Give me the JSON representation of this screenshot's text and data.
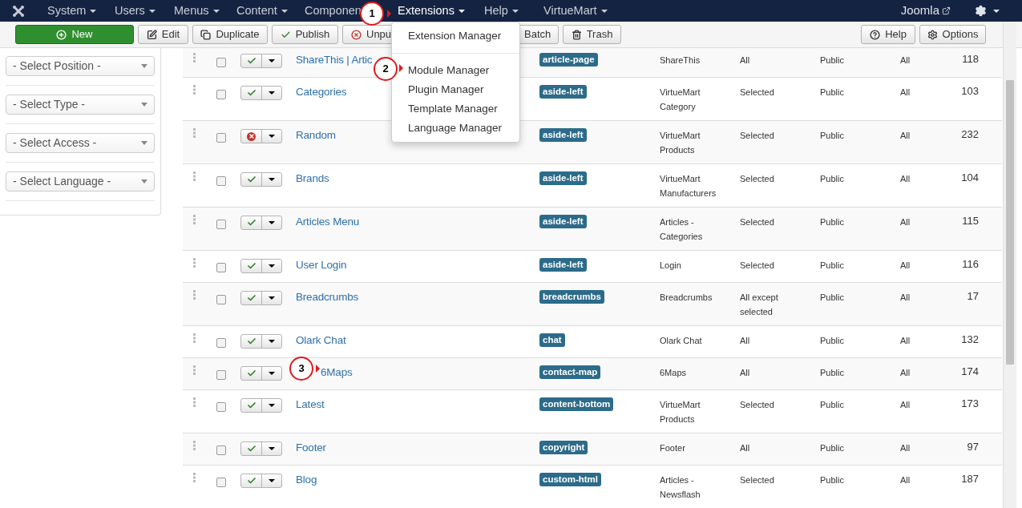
{
  "navbar": {
    "menus": [
      {
        "label": "System",
        "selected": false
      },
      {
        "label": "Users",
        "selected": false
      },
      {
        "label": "Menus",
        "selected": false
      },
      {
        "label": "Content",
        "selected": false
      },
      {
        "label": "Componen",
        "selected": false
      },
      {
        "label": "Extensions",
        "selected": true
      },
      {
        "label": "Help",
        "selected": false
      },
      {
        "label": "VirtueMart",
        "selected": false
      }
    ],
    "site_link": "Joomla"
  },
  "dropdown": {
    "items": [
      {
        "label": "Extension Manager",
        "kind": "item"
      },
      {
        "kind": "divider"
      },
      {
        "label": "Module Manager",
        "kind": "item"
      },
      {
        "label": "Plugin Manager",
        "kind": "item"
      },
      {
        "label": "Template Manager",
        "kind": "item"
      },
      {
        "label": "Language Manager",
        "kind": "item"
      }
    ]
  },
  "toolbar": {
    "left": [
      {
        "label": "New",
        "kind": "new"
      },
      {
        "label": "Edit",
        "kind": "edit"
      },
      {
        "label": "Duplicate",
        "kind": "duplicate"
      },
      {
        "label": "Publish",
        "kind": "publish"
      },
      {
        "label": "Unpu",
        "kind": "unpublish"
      },
      {
        "label": "Batch",
        "kind": "batch"
      },
      {
        "label": "Trash",
        "kind": "trash"
      }
    ],
    "right": [
      {
        "label": "Help",
        "kind": "help"
      },
      {
        "label": "Options",
        "kind": "options"
      }
    ]
  },
  "filters": [
    "- Select Position -",
    "- Select Type -",
    "- Select Access -",
    "- Select Language -"
  ],
  "rows": [
    {
      "title": "ShareThis | Artic",
      "published": true,
      "checked": false,
      "position": "article-page",
      "type": "ShareThis",
      "pages": "All",
      "access": "Public",
      "language": "All",
      "id": "118"
    },
    {
      "title": "Categories",
      "published": true,
      "checked": false,
      "position": "aside-left",
      "type": "VirtueMart Category",
      "pages": "Selected",
      "access": "Public",
      "language": "All",
      "id": "103"
    },
    {
      "title": "Random",
      "published": false,
      "checked": false,
      "position": "aside-left",
      "type": "VirtueMart Products",
      "pages": "Selected",
      "access": "Public",
      "language": "All",
      "id": "232"
    },
    {
      "title": "Brands",
      "published": true,
      "checked": false,
      "position": "aside-left",
      "type": "VirtueMart Manufacturers",
      "pages": "Selected",
      "access": "Public",
      "language": "All",
      "id": "104"
    },
    {
      "title": "Articles Menu",
      "published": true,
      "checked": false,
      "position": "aside-left",
      "type": "Articles - Categories",
      "pages": "Selected",
      "access": "Public",
      "language": "All",
      "id": "115"
    },
    {
      "title": "User Login",
      "published": true,
      "checked": false,
      "position": "aside-left",
      "type": "Login",
      "pages": "Selected",
      "access": "Public",
      "language": "All",
      "id": "116"
    },
    {
      "title": "Breadcrumbs",
      "published": true,
      "checked": false,
      "position": "breadcrumbs",
      "type": "Breadcrumbs",
      "pages": "All except selected",
      "access": "Public",
      "language": "All",
      "id": "17"
    },
    {
      "title": "Olark Chat",
      "published": true,
      "checked": false,
      "position": "chat",
      "type": "Olark Chat",
      "pages": "All",
      "access": "Public",
      "language": "All",
      "id": "132"
    },
    {
      "title": "6Maps",
      "published": true,
      "checked": false,
      "position": "contact-map",
      "type": "6Maps",
      "pages": "All",
      "access": "Public",
      "language": "All",
      "id": "174"
    },
    {
      "title": "Latest",
      "published": true,
      "checked": false,
      "position": "content-bottom",
      "type": "VirtueMart Products",
      "pages": "Selected",
      "access": "Public",
      "language": "All",
      "id": "173"
    },
    {
      "title": "Footer",
      "published": true,
      "checked": false,
      "position": "copyright",
      "type": "Footer",
      "pages": "All",
      "access": "Public",
      "language": "All",
      "id": "97"
    },
    {
      "title": "Blog",
      "published": true,
      "checked": false,
      "position": "custom-html",
      "type": "Articles - Newsflash",
      "pages": "Selected",
      "access": "Public",
      "language": "All",
      "id": "187"
    }
  ],
  "callouts": [
    "1",
    "2",
    "3"
  ]
}
